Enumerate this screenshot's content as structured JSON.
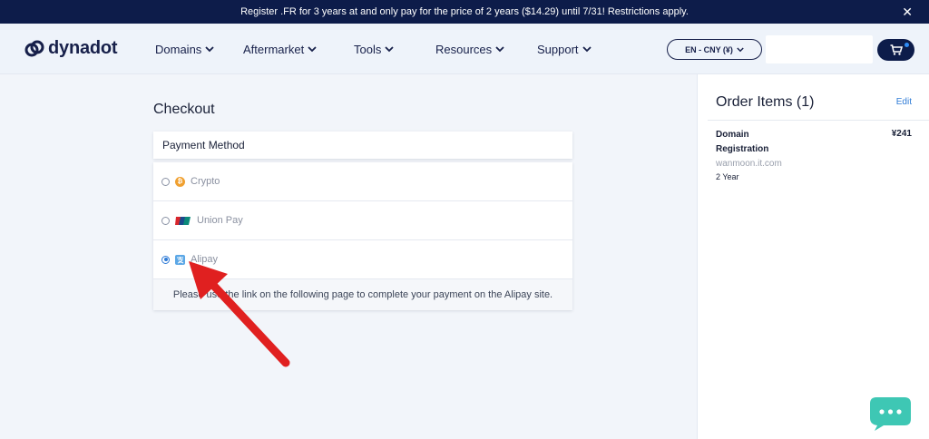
{
  "promo": {
    "text": "Register .FR for 3 years at and only pay for the price of 2 years ($14.29) until 7/31! Restrictions apply.",
    "close_icon": "close-icon"
  },
  "header": {
    "logo_text": "dynadot",
    "nav": [
      {
        "label": "Domains"
      },
      {
        "label": "Aftermarket"
      },
      {
        "label": "Tools"
      },
      {
        "label": "Resources"
      },
      {
        "label": "Support"
      }
    ],
    "language": "EN - CNY (¥)",
    "search_value": "",
    "cart_icon": "cart-icon"
  },
  "checkout": {
    "title": "Checkout",
    "payment_method_title": "Payment Method",
    "options": [
      {
        "label": "Crypto",
        "icon": "bitcoin-icon",
        "selected": false
      },
      {
        "label": "Union Pay",
        "icon": "unionpay-icon",
        "selected": false
      },
      {
        "label": "Alipay",
        "icon": "alipay-icon",
        "selected": true
      }
    ],
    "alipay_note": "Please use the link on the following page to complete your payment on the Alipay site."
  },
  "order": {
    "title": "Order Items (1)",
    "edit_label": "Edit",
    "items": [
      {
        "name": "Domain Registration",
        "price": "¥241",
        "domain": "wanmoon.it.com",
        "term": "2 Year"
      }
    ]
  },
  "annotation": {
    "arrow_color": "#e02020",
    "arrow_target": "Alipay"
  },
  "colors": {
    "navy": "#0d1c4a",
    "accent": "#2e7bd6",
    "background": "#f2f5fa"
  }
}
